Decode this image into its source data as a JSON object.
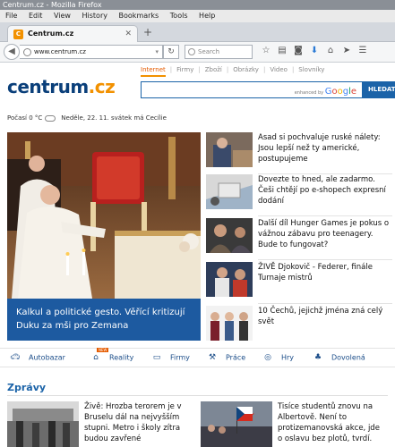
{
  "browser": {
    "window_title": "Centrum.cz - Mozilla Firefox",
    "menu": [
      "File",
      "Edit",
      "View",
      "History",
      "Bookmarks",
      "Tools",
      "Help"
    ],
    "tab_title": "Centrum.cz",
    "tab_favicon": "C",
    "url": "www.centrum.cz",
    "search_placeholder": "Search"
  },
  "header": {
    "section_tabs": [
      "Internet",
      "Firmy",
      "Zboží",
      "Obrázky",
      "Video",
      "Slovníky"
    ],
    "active_tab": "Internet",
    "logo_main": "centrum",
    "logo_tld": ".cz",
    "enhanced_by": "enhanced by",
    "google": "Google",
    "search_button": "HLEDAT"
  },
  "weather": {
    "text": "Počasí 0 °C",
    "date": "Neděle, 22. 11. svátek má Cecílie"
  },
  "hero": {
    "caption": "Kalkul a politické gesto. Věřící kritizují Duku za mši pro Zemana"
  },
  "news": [
    {
      "text": "Asad si pochvaluje ruské nálety: Jsou lepší než ty americké, postupujeme"
    },
    {
      "text": "Dovezte to hned, ale zadarmo. Češi chtějí po e-shopech expresní dodání"
    },
    {
      "text": "Další díl Hunger Games je pokus o vážnou zábavu pro teenagery. Bude to fungovat?"
    },
    {
      "text": "ŽIVĚ Djokovič - Federer, finále Turnaje mistrů"
    },
    {
      "text": "10 Čechů, jejichž jména zná celý svět"
    }
  ],
  "services": [
    {
      "label": "Autobazar",
      "icon": "car-icon"
    },
    {
      "label": "Reality",
      "icon": "house-icon",
      "badge": "NEW"
    },
    {
      "label": "Firmy",
      "icon": "folder-icon"
    },
    {
      "label": "Práce",
      "icon": "tools-icon"
    },
    {
      "label": "Hry",
      "icon": "gamepad-icon"
    },
    {
      "label": "Dovolená",
      "icon": "palm-icon"
    }
  ],
  "zpravy": {
    "heading": "Zprávy",
    "items": [
      {
        "text": "Živě: Hrozba terorem je v Bruselu dál na nejvyšším stupni. Metro i školy zítra budou zavřené"
      },
      {
        "text": "Tisíce studentů znovu na Albertově. Není to protizemanovská akce, jde o oslavu bez plotů, tvrdí."
      }
    ]
  },
  "colors": {
    "brand_blue": "#1b63a8",
    "brand_orange": "#f29100",
    "caption_bg": "#1d5aa0"
  }
}
